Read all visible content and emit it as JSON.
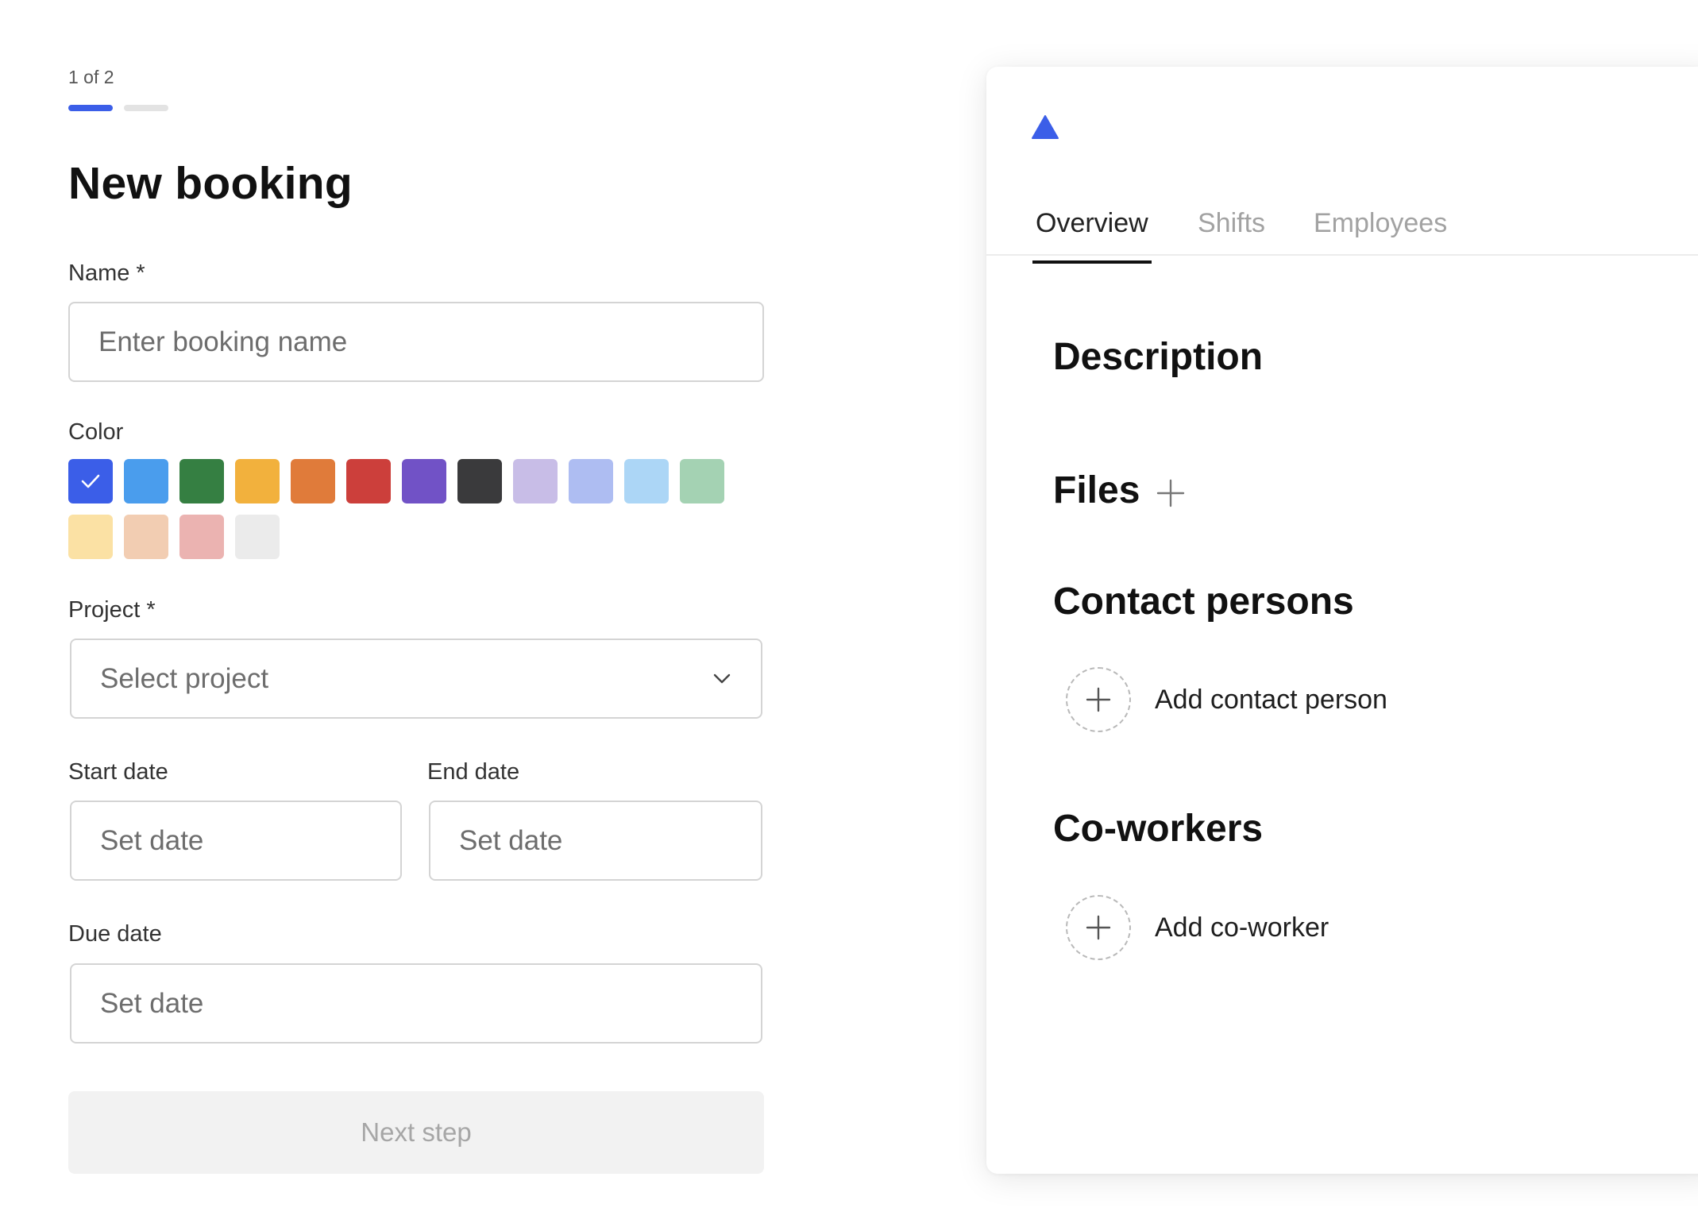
{
  "form": {
    "step_indicator": "1 of 2",
    "title": "New booking",
    "name": {
      "label": "Name *",
      "placeholder": "Enter booking name",
      "value": ""
    },
    "color": {
      "label": "Color",
      "selected_index": 0,
      "swatches": [
        "#3b5ee8",
        "#4a9ded",
        "#357f42",
        "#f2b13d",
        "#e07b3a",
        "#cc3f3b",
        "#7152c6",
        "#3a3a3c",
        "#c8bde7",
        "#aebdf2",
        "#acd6f6",
        "#a4d2b3",
        "#fbe1a4",
        "#f2cdb2",
        "#ebb3b1",
        "#ebebeb"
      ]
    },
    "project": {
      "label": "Project *",
      "placeholder": "Select project"
    },
    "start_date": {
      "label": "Start date",
      "placeholder": "Set date"
    },
    "end_date": {
      "label": "End date",
      "placeholder": "Set date"
    },
    "due_date": {
      "label": "Due date",
      "placeholder": "Set date"
    },
    "next_button": "Next step"
  },
  "panel": {
    "tabs": [
      {
        "label": "Overview",
        "active": true
      },
      {
        "label": "Shifts",
        "active": false
      },
      {
        "label": "Employees",
        "active": false
      }
    ],
    "sections": {
      "description": "Description",
      "files": "Files",
      "contact_persons": "Contact persons",
      "co_workers": "Co-workers"
    },
    "add_contact_person": "Add contact person",
    "add_co_worker": "Add co-worker"
  },
  "colors": {
    "accent": "#3b5ee8",
    "disabled_button": "#f2f2f2"
  },
  "icons": [
    "checkmark-icon",
    "chevron-down-icon",
    "logo-triangle-icon",
    "plus-icon"
  ]
}
